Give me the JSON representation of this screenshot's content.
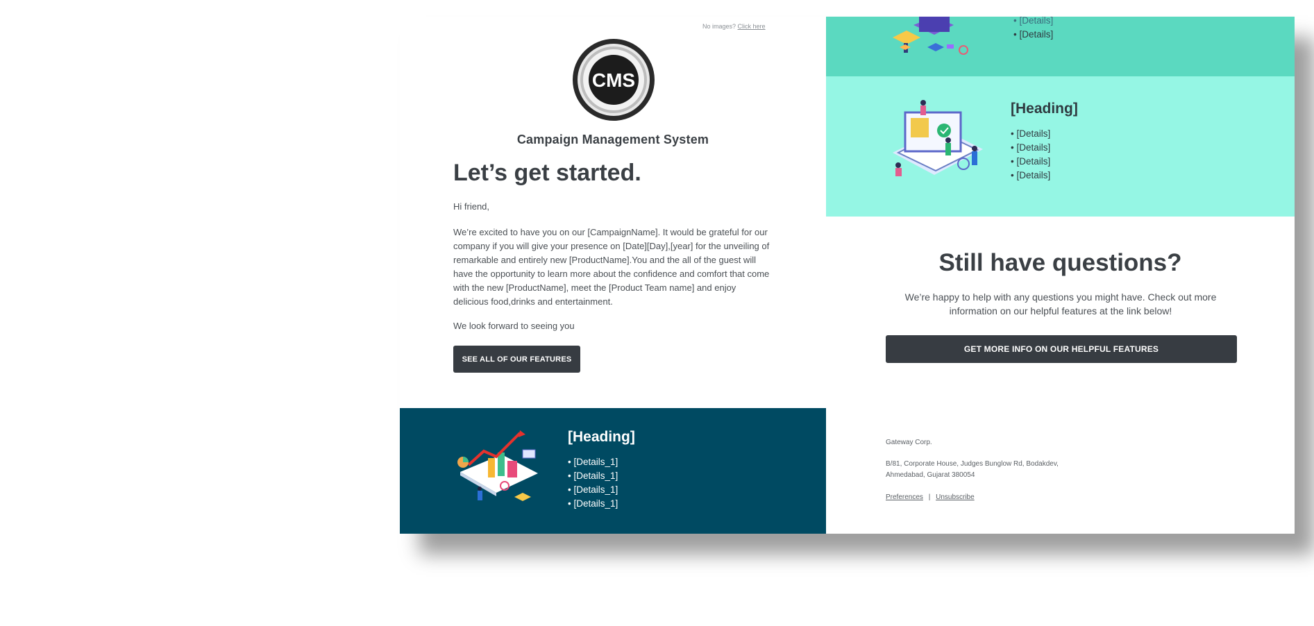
{
  "header": {
    "noimages_text": "No images?",
    "noimages_link": "Click here",
    "logo_text": "CMS",
    "brand_name": "Campaign Management System"
  },
  "intro": {
    "title": "Let’s get started.",
    "greeting": "Hi friend,",
    "paragraph": "We’re excited to have you on our [CampaignName]. It would be grateful for our company if you will give your presence on [Date][Day],[year] for the unveiling of remarkable and entirely new [ProductName].You and the all of the guest will have the opportunity to learn more about the confidence and comfort that come with the new [ProductName], meet the [Product Team name] and enjoy delicious food,drinks and entertainment.",
    "closing": "We look forward to seeing you",
    "button": "SEE ALL OF OUR FEATURES"
  },
  "teal_top": {
    "items": [
      "[Details]",
      "[Details]"
    ]
  },
  "teal_block": {
    "heading": "[Heading]",
    "items": [
      "[Details]",
      "[Details]",
      "[Details]",
      "[Details]"
    ]
  },
  "navy_block": {
    "heading": "[Heading]",
    "items": [
      "[Details_1]",
      "[Details_1]",
      "[Details_1]",
      "[Details_1]"
    ]
  },
  "questions": {
    "title": "Still have questions?",
    "body": "We’re happy to help with any questions you might have. Check out more information on our helpful features at the link below!",
    "button": "GET MORE INFO ON OUR HELPFUL FEATURES"
  },
  "footer": {
    "company": "Gateway Corp.",
    "address_line1": "B/81, Corporate House, Judges Bunglow Rd, Bodakdev,",
    "address_line2": "Ahmedabad, Gujarat 380054",
    "preferences": "Preferences",
    "separator": "|",
    "unsubscribe": "Unsubscribe"
  },
  "colors": {
    "dark_button": "#373c42",
    "teal_dark": "#5bd9c0",
    "teal_light": "#95f6e4",
    "navy": "#004a62",
    "text": "#3a3f44"
  },
  "icons": [
    "cms-logo-icon",
    "isometric-buildings-illustration",
    "isometric-computer-illustration",
    "isometric-chart-illustration"
  ]
}
